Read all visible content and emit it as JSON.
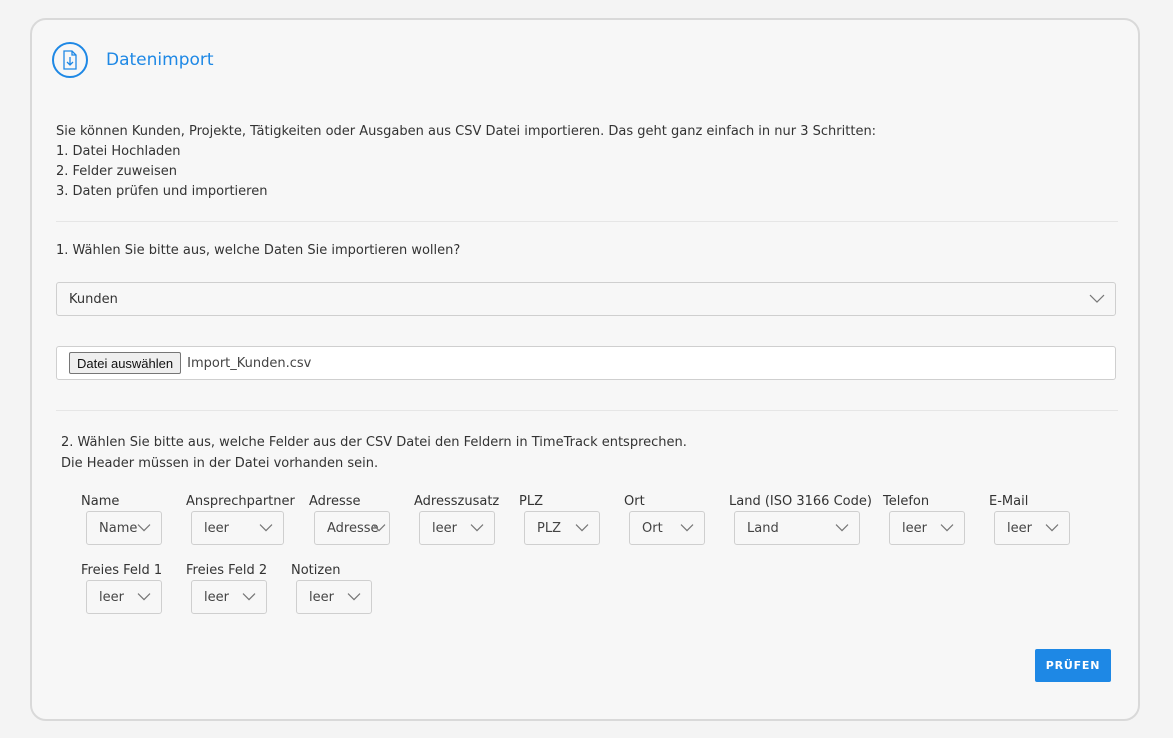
{
  "header": {
    "title": "Datenimport",
    "icon": "file-import-icon"
  },
  "intro": {
    "text": "Sie können Kunden, Projekte, Tätigkeiten oder Ausgaben aus CSV Datei importieren. Das geht ganz einfach in nur 3 Schritten:",
    "steps": [
      "1. Datei Hochladen",
      "2. Felder zuweisen",
      "3. Daten prüfen und importieren"
    ]
  },
  "step1": {
    "question": "1. Wählen Sie bitte aus, welche Daten Sie importieren wollen?",
    "selected": "Kunden",
    "file_button": "Datei auswählen",
    "file_name": "Import_Kunden.csv"
  },
  "step2": {
    "line1": "2. Wählen Sie bitte aus, welche Felder aus der CSV Datei den Feldern in TimeTrack entsprechen.",
    "line2": "Die Header müssen in der Datei vorhanden sein.",
    "fields": [
      {
        "label": "Name",
        "value": "Name"
      },
      {
        "label": "Ansprechpartner",
        "value": "leer"
      },
      {
        "label": "Adresse",
        "value": "Adresse"
      },
      {
        "label": "Adresszusatz",
        "value": "leer"
      },
      {
        "label": "PLZ",
        "value": "PLZ"
      },
      {
        "label": "Ort",
        "value": "Ort"
      },
      {
        "label": "Land (ISO 3166 Code)",
        "value": "Land"
      },
      {
        "label": "Telefon",
        "value": "leer"
      },
      {
        "label": "E-Mail",
        "value": "leer"
      },
      {
        "label": "Freies Feld 1",
        "value": "leer"
      },
      {
        "label": "Freies Feld 2",
        "value": "leer"
      },
      {
        "label": "Notizen",
        "value": "leer"
      }
    ]
  },
  "actions": {
    "check_button": "PRÜFEN"
  },
  "colors": {
    "accent": "#1e88e5",
    "border": "#cfcfcf",
    "background": "#f7f7f7"
  }
}
